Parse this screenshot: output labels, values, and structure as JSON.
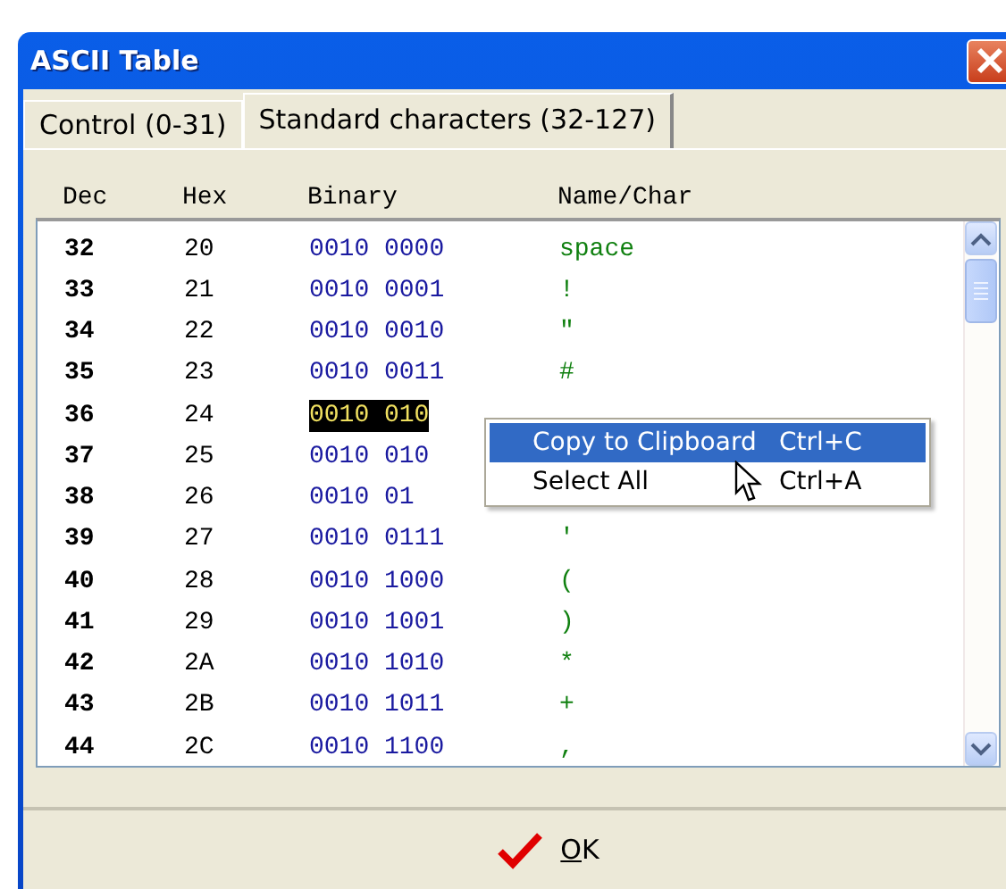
{
  "window": {
    "title": "ASCII Table"
  },
  "tabs": [
    {
      "label": "Control (0-31)",
      "selected": false
    },
    {
      "label": "Standard characters (32-127)",
      "selected": true
    }
  ],
  "table": {
    "columns": [
      "Dec",
      "Hex",
      "Binary",
      "Name/Char"
    ],
    "rows": [
      {
        "dec": "32",
        "hex": "20",
        "binary": "0010 0000",
        "name": "space",
        "selected": false
      },
      {
        "dec": "33",
        "hex": "21",
        "binary": "0010 0001",
        "name": "!",
        "selected": false
      },
      {
        "dec": "34",
        "hex": "22",
        "binary": "0010 0010",
        "name": "\"",
        "selected": false
      },
      {
        "dec": "35",
        "hex": "23",
        "binary": "0010 0011",
        "name": "#",
        "selected": false
      },
      {
        "dec": "36",
        "hex": "24",
        "binary": "0010 010",
        "selected": true
      },
      {
        "dec": "37",
        "hex": "25",
        "binary": "0010 010",
        "selected": false
      },
      {
        "dec": "38",
        "hex": "26",
        "binary": "0010 01",
        "selected": false
      },
      {
        "dec": "39",
        "hex": "27",
        "binary": "0010 0111",
        "name": "'",
        "selected": false
      },
      {
        "dec": "40",
        "hex": "28",
        "binary": "0010 1000",
        "name": "(",
        "selected": false
      },
      {
        "dec": "41",
        "hex": "29",
        "binary": "0010 1001",
        "name": ")",
        "selected": false
      },
      {
        "dec": "42",
        "hex": "2A",
        "binary": "0010 1010",
        "name": "*",
        "selected": false
      },
      {
        "dec": "43",
        "hex": "2B",
        "binary": "0010 1011",
        "name": "+",
        "selected": false
      },
      {
        "dec": "44",
        "hex": "2C",
        "binary": "0010 1100",
        "name": ",",
        "selected": false
      }
    ]
  },
  "context_menu": {
    "items": [
      {
        "label": "Copy to Clipboard",
        "shortcut": "Ctrl+C",
        "selected": true
      },
      {
        "label": "Select All",
        "shortcut": "Ctrl+A",
        "selected": false
      }
    ]
  },
  "buttons": [
    {
      "label": "OK"
    }
  ]
}
